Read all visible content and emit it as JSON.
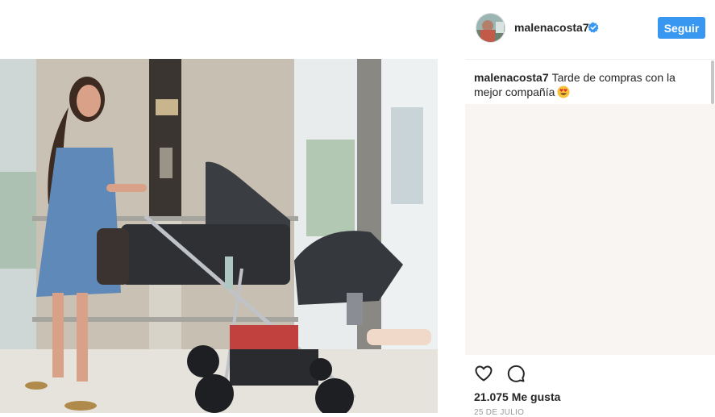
{
  "post": {
    "photo_icon": "photo",
    "username": "malenacosta7",
    "verified_icon": "verified-badge-icon",
    "follow_label": "Seguir",
    "caption_user": "malenacosta7",
    "caption_text": "Tarde de compras con la mejor compañía",
    "caption_emoji": "heart-eyes-emoji",
    "likes": "21.075 Me gusta",
    "timestamp": "25 DE JULIO",
    "colors": {
      "follow_button": "#3897f0",
      "verified": "#3897f0",
      "comments_bg": "#f8f5f2"
    }
  },
  "icons": {
    "like": "heart-outline-icon",
    "comment": "comment-bubble-icon"
  }
}
